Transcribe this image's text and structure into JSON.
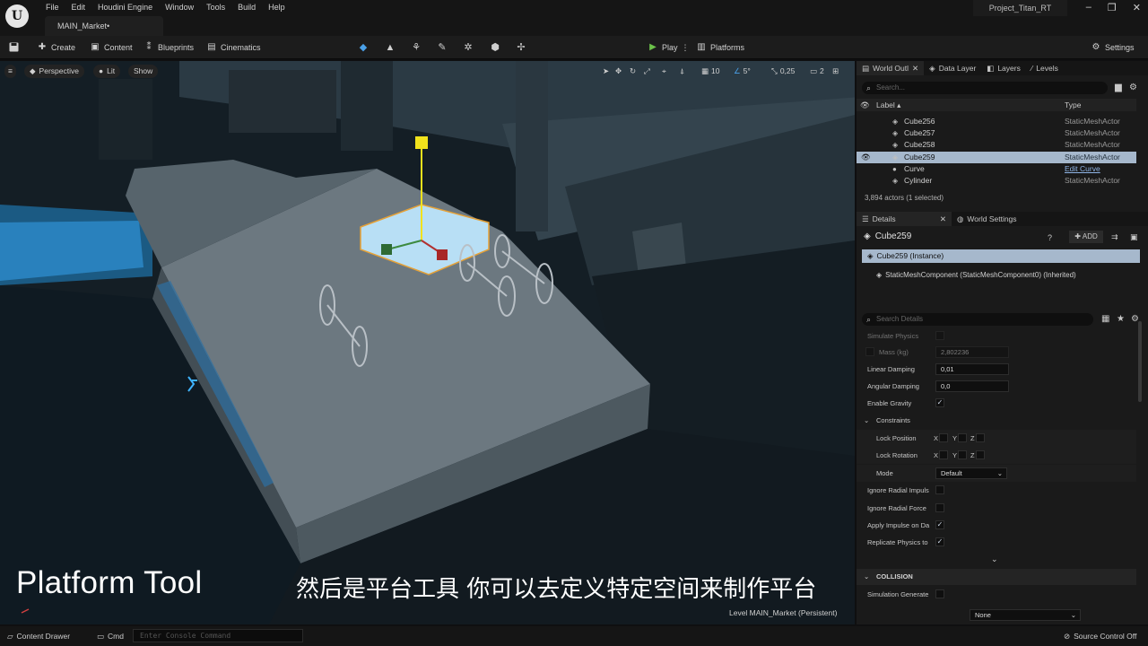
{
  "window": {
    "logo": "U",
    "menu": [
      "File",
      "Edit",
      "Houdini Engine",
      "Window",
      "Tools",
      "Build",
      "Help"
    ],
    "doc_tab": "MAIN_Market•",
    "project": "Project_Titan_RT",
    "controls": [
      "–",
      "❐",
      "✕"
    ]
  },
  "toolbar": {
    "save_icon": "save-icon",
    "create": "Create",
    "content": "Content",
    "blueprints": "Blueprints",
    "cinematics": "Cinematics",
    "play": "Play",
    "platforms": "Platforms",
    "settings": "Settings"
  },
  "viewport": {
    "menu_icon": "≡",
    "perspective": "Perspective",
    "lit": "Lit",
    "show": "Show",
    "grid_value": "10",
    "angle_value": "5°",
    "scale_value": "0,25",
    "camera_speed": "2",
    "caption_en": "Platform Tool",
    "caption_cn": "然后是平台工具  你可以去定义特定空间来制作平台",
    "level_label": "Level  MAIN_Market (Persistent)"
  },
  "outliner": {
    "tabs": [
      "World Outl",
      "Data Layer",
      "Layers",
      "Levels"
    ],
    "search_placeholder": "Search...",
    "col_label": "Label ▴",
    "col_type": "Type",
    "rows": [
      {
        "name": "Cube256",
        "type": "StaticMeshActor"
      },
      {
        "name": "Cube257",
        "type": "StaticMeshActor"
      },
      {
        "name": "Cube258",
        "type": "StaticMeshActor"
      },
      {
        "name": "Cube259",
        "type": "StaticMeshActor"
      },
      {
        "name": "Curve",
        "type": "Edit Curve"
      },
      {
        "name": "Cylinder",
        "type": "StaticMeshActor"
      }
    ],
    "count": "3,894 actors (1 selected)"
  },
  "details": {
    "tabs": [
      "Details",
      "World Settings"
    ],
    "object_name": "Cube259",
    "add_label": "ADD",
    "instance": "Cube259 (Instance)",
    "component": "StaticMeshComponent (StaticMeshComponent0) (Inherited)",
    "search_placeholder": "Search Details",
    "props": {
      "simulate_physics": "Simulate Physics",
      "mass": "Mass (kg)",
      "mass_value": "2,802236",
      "linear_damping": "Linear Damping",
      "linear_damping_value": "0,01",
      "angular_damping": "Angular Damping",
      "angular_damping_value": "0,0",
      "enable_gravity": "Enable Gravity",
      "constraints": "Constraints",
      "lock_position": "Lock Position",
      "lock_rotation": "Lock Rotation",
      "mode": "Mode",
      "mode_value": "Default",
      "x": "X",
      "y": "Y",
      "z": "Z",
      "ignore_radial_impulse": "Ignore Radial Impuls",
      "ignore_radial_force": "Ignore Radial Force",
      "apply_impulse": "Apply Impulse on Da",
      "replicate_physics": "Replicate Physics to",
      "collision": "COLLISION",
      "simulation_generates": "Simulation Generate",
      "none_value": "None"
    }
  },
  "bottom": {
    "content_drawer": "Content Drawer",
    "cmd": "Cmd",
    "console_placeholder": "Enter Console Command",
    "source_control": "Source Control Off"
  }
}
